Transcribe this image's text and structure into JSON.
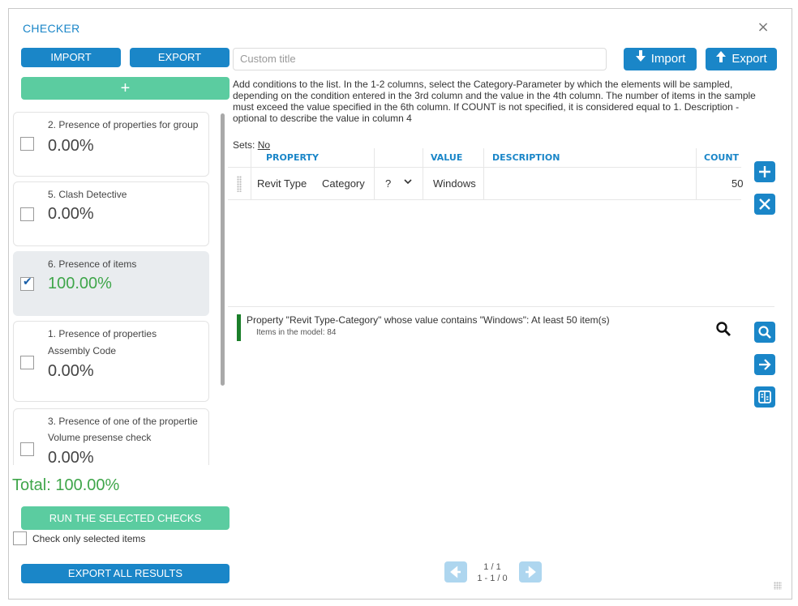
{
  "window": {
    "title": "CHECKER",
    "close_icon": "×"
  },
  "left_toolbar": {
    "import_label": "IMPORT",
    "export_label": "EXPORT",
    "add_label": "+"
  },
  "checks": [
    {
      "title": "2. Presence of properties for group",
      "subtitle": "",
      "percent": "0.00%",
      "checked": false,
      "selected": false
    },
    {
      "title": "5. Clash Detective",
      "subtitle": "",
      "percent": "0.00%",
      "checked": false,
      "selected": false
    },
    {
      "title": "6. Presence of items",
      "subtitle": "",
      "percent": "100.00%",
      "checked": true,
      "selected": true
    },
    {
      "title": "1. Presence of properties",
      "subtitle": "Assembly Code",
      "percent": "0.00%",
      "checked": false,
      "selected": false
    },
    {
      "title": "3. Presence of one of the propertie",
      "subtitle": "Volume presense check",
      "percent": "0.00%",
      "checked": false,
      "selected": false
    }
  ],
  "total": "Total: 100.00%",
  "run_label": "RUN THE SELECTED CHECKS",
  "check_only_selected_label": "Check only selected items",
  "export_all_label": "EXPORT ALL RESULTS",
  "right_toolbar": {
    "title_placeholder": "Custom title",
    "import_label": "Import",
    "export_label": "Export"
  },
  "description": "Add conditions to the list. In the 1-2 columns, select the Category-Parameter by which the elements will be sampled, depending on the condition entered in the 3rd column and the value in the 4th column. The number of items in the sample must exceed the value specified in the 6th column. If COUNT is not specified, it is considered equal to 1. Description - optional to describe the value in column 4",
  "sets": {
    "label": "Sets:",
    "value": "No"
  },
  "grid": {
    "headers": {
      "property": "PROPERTY",
      "value": "VALUE",
      "description": "DESCRIPTION",
      "count": "COUNT"
    },
    "rows": [
      {
        "property": "Revit Type",
        "parameter": "Category",
        "condition": "?",
        "value": "Windows",
        "description": "",
        "count": "50"
      }
    ]
  },
  "result": {
    "text": "Property \"Revit Type-Category\" whose value contains \"Windows\": At least 50 item(s)",
    "sub": "Items in the model: 84",
    "status_color": "#1b7f2a"
  },
  "pager": {
    "page": "1 / 1",
    "range": "1 - 1 / 0"
  },
  "colors": {
    "accent": "#1a86c8",
    "green_button": "#5bcca0",
    "success_text": "#3fa64a"
  }
}
